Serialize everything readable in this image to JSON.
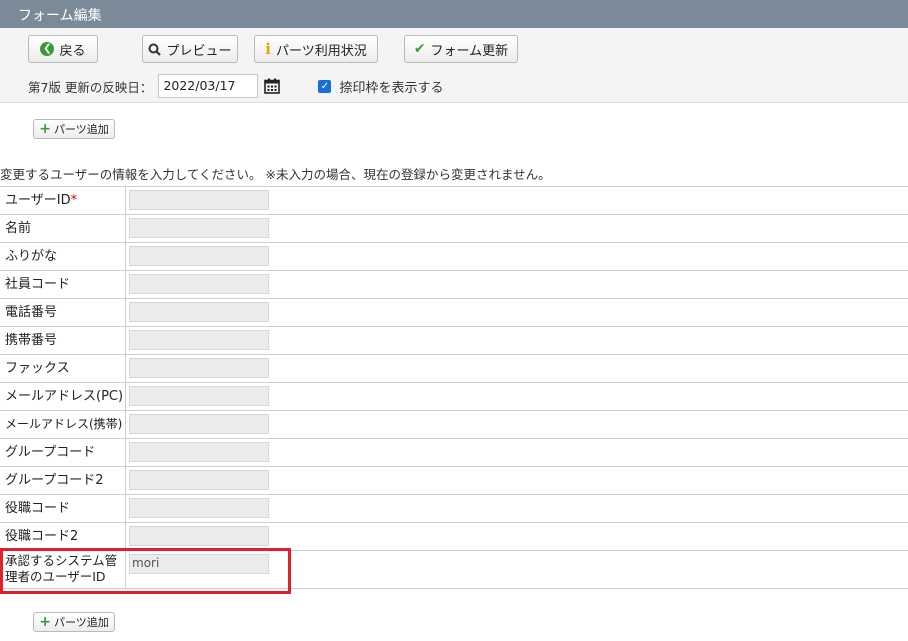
{
  "window": {
    "title": "フォーム編集"
  },
  "toolbar": {
    "back_label": "戻る",
    "preview_label": "プレビュー",
    "parts_usage_label": "パーツ利用状況",
    "update_form_label": "フォーム更新"
  },
  "version": {
    "label": "第7版 更新の反映日：",
    "date_value": "2022/03/17",
    "stamp_checkbox_label": "捺印枠を表示する",
    "stamp_checked": true
  },
  "add_parts_label": "パーツ追加",
  "instruction": "変更するユーザーの情報を入力してください。 ※未入力の場合、現在の登録から変更されません。",
  "fields": [
    {
      "label": "ユーザーID",
      "required_mark": "*",
      "value": ""
    },
    {
      "label": "名前",
      "value": ""
    },
    {
      "label": "ふりがな",
      "value": ""
    },
    {
      "label": "社員コード",
      "value": ""
    },
    {
      "label": "電話番号",
      "value": ""
    },
    {
      "label": "携帯番号",
      "value": ""
    },
    {
      "label": "ファックス",
      "value": ""
    },
    {
      "label": "メールアドレス(PC)",
      "value": ""
    },
    {
      "label": "メールアドレス(携帯)",
      "value": ""
    },
    {
      "label": "グループコード",
      "value": ""
    },
    {
      "label": "グループコード2",
      "value": ""
    },
    {
      "label": "役職コード",
      "value": ""
    },
    {
      "label": "役職コード2",
      "value": ""
    },
    {
      "label": "承認するシステム管理者のユーザーID",
      "value": "mori"
    }
  ],
  "colors": {
    "title_bar": "#7b8a99",
    "highlight": "#e0202a",
    "accent_green": "#3a9a3a",
    "checkbox_blue": "#1a6fd6"
  }
}
